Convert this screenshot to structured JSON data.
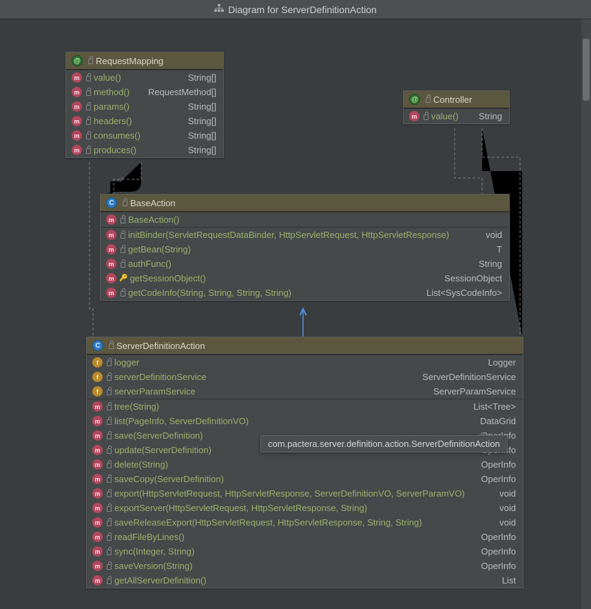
{
  "title": "Diagram for ServerDefinitionAction",
  "tooltip": "com.pactera.server.definition.action.ServerDefinitionAction",
  "classes": {
    "requestMapping": {
      "name": "RequestMapping",
      "kind": "annotation",
      "methods": [
        {
          "name": "value()",
          "type": "String[]"
        },
        {
          "name": "method()",
          "type": "RequestMethod[]"
        },
        {
          "name": "params()",
          "type": "String[]"
        },
        {
          "name": "headers()",
          "type": "String[]"
        },
        {
          "name": "consumes()",
          "type": "String[]"
        },
        {
          "name": "produces()",
          "type": "String[]"
        }
      ]
    },
    "controller": {
      "name": "Controller",
      "kind": "annotation",
      "methods": [
        {
          "name": "value()",
          "type": "String"
        }
      ]
    },
    "baseAction": {
      "name": "BaseAction",
      "kind": "class",
      "constructors": [
        {
          "name": "BaseAction()"
        }
      ],
      "methods": [
        {
          "name": "initBinder(ServletRequestDataBinder, HttpServletRequest, HttpServletResponse)",
          "type": "void"
        },
        {
          "name": "getBean(String)",
          "type": "T"
        },
        {
          "name": "authFunc()",
          "type": "String"
        },
        {
          "name": "getSessionObject()",
          "type": "SessionObject",
          "protected": true
        },
        {
          "name": "getCodeInfo(String, String, String, String)",
          "type": "List<SysCodeInfo>"
        }
      ]
    },
    "serverDefinitionAction": {
      "name": "ServerDefinitionAction",
      "kind": "class",
      "fields": [
        {
          "name": "logger",
          "type": "Logger"
        },
        {
          "name": "serverDefinitionService",
          "type": "ServerDefinitionService",
          "private": true
        },
        {
          "name": "serverParamService",
          "type": "ServerParamService",
          "private": true
        }
      ],
      "methods": [
        {
          "name": "tree(String)",
          "type": "List<Tree>"
        },
        {
          "name": "list(PageInfo, ServerDefinitionVO)",
          "type": "DataGrid"
        },
        {
          "name": "save(ServerDefinition)",
          "type": "OperInfo"
        },
        {
          "name": "update(ServerDefinition)",
          "type": "OperInfo"
        },
        {
          "name": "delete(String)",
          "type": "OperInfo"
        },
        {
          "name": "saveCopy(ServerDefinition)",
          "type": "OperInfo"
        },
        {
          "name": "export(HttpServletRequest, HttpServletResponse, ServerDefinitionVO, ServerParamVO)",
          "type": "void"
        },
        {
          "name": "exportServer(HttpServletRequest, HttpServletResponse, String)",
          "type": "void"
        },
        {
          "name": "saveReleaseExport(HttpServletRequest, HttpServletResponse, String, String)",
          "type": "void"
        },
        {
          "name": "readFileByLines()",
          "type": "OperInfo"
        },
        {
          "name": "sync(Integer, String)",
          "type": "OperInfo"
        },
        {
          "name": "saveVersion(String)",
          "type": "OperInfo"
        },
        {
          "name": "getAllServerDefinition()",
          "type": "List"
        }
      ]
    }
  }
}
